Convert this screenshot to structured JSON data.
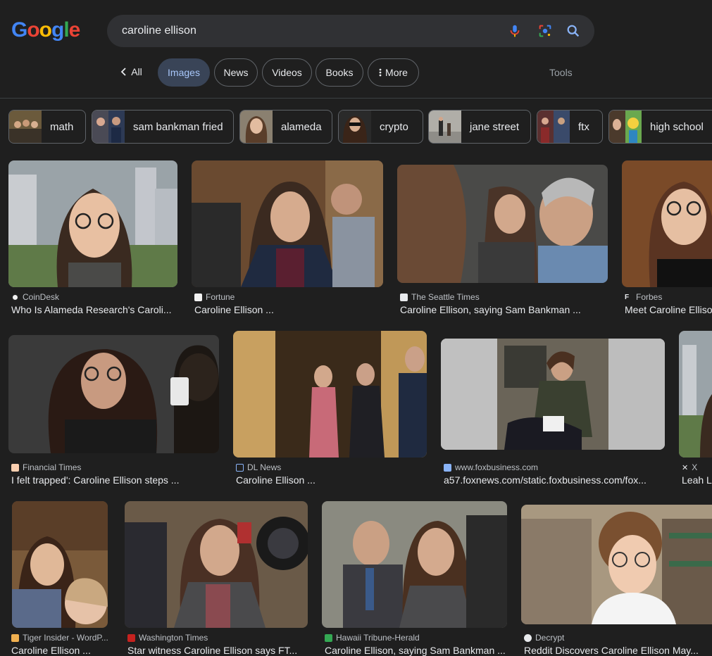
{
  "logo": {
    "letters": [
      "G",
      "o",
      "o",
      "g",
      "l",
      "e"
    ]
  },
  "search": {
    "query": "caroline ellison"
  },
  "icons": {
    "mic": "mic-icon",
    "lens": "lens-icon",
    "search": "search-icon",
    "back": "chevron-left-icon",
    "more": "more-vert-icon"
  },
  "tabs": {
    "all": "All",
    "images": "Images",
    "news": "News",
    "videos": "Videos",
    "books": "Books",
    "more": "More",
    "tools": "Tools"
  },
  "chips": [
    "math",
    "sam bankman fried",
    "alameda",
    "crypto",
    "jane street",
    "ftx",
    "high school"
  ],
  "results": [
    {
      "source": "CoinDesk",
      "title": "Who Is Alameda Research's Caroli..."
    },
    {
      "source": "Fortune",
      "title": "Caroline Ellison ..."
    },
    {
      "source": "The Seattle Times",
      "title": "Caroline Ellison, saying Sam Bankman ..."
    },
    {
      "source": "Forbes",
      "title": "Meet Caroline Elliso"
    },
    {
      "source": "Financial Times",
      "title": "I felt trapped': Caroline Ellison steps ..."
    },
    {
      "source": "DL News",
      "title": "Caroline Ellison ..."
    },
    {
      "source": "www.foxbusiness.com",
      "title": "a57.foxnews.com/static.foxbusiness.com/fox..."
    },
    {
      "source": "X",
      "title": "Leah L"
    },
    {
      "source": "Tiger Insider - WordP...",
      "title": "Caroline Ellison ..."
    },
    {
      "source": "Washington Times",
      "title": "Star witness Caroline Ellison says FT..."
    },
    {
      "source": "Hawaii Tribune-Herald",
      "title": "Caroline Ellison, saying Sam Bankman ..."
    },
    {
      "source": "Decrypt",
      "title": "Reddit Discovers Caroline Ellison May..."
    }
  ]
}
